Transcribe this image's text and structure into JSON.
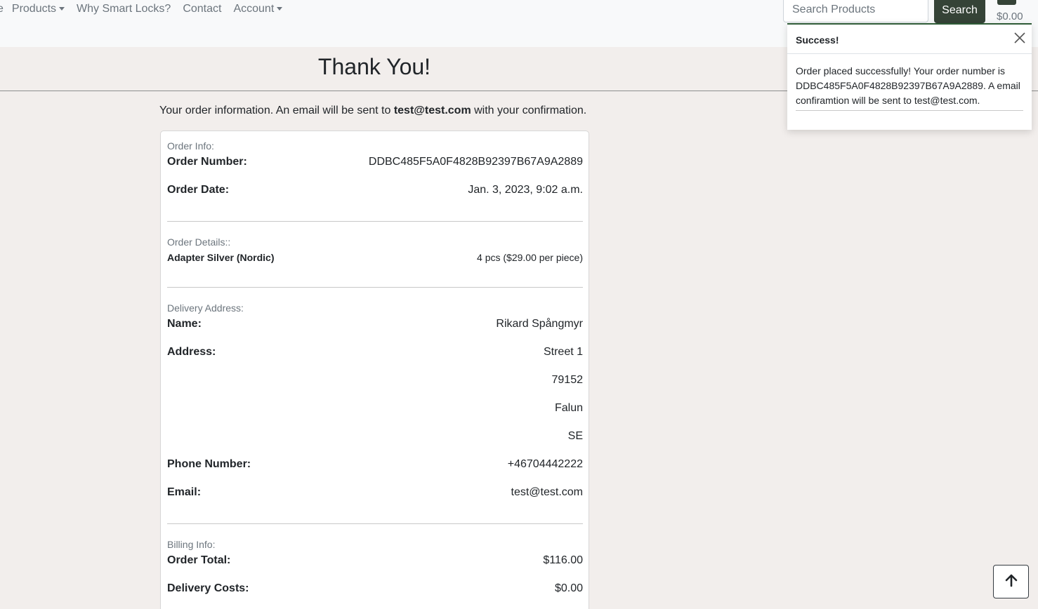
{
  "nav": {
    "cut_label": "e",
    "items": [
      {
        "label": "Products",
        "dropdown": true
      },
      {
        "label": "Why Smart Locks?",
        "dropdown": false
      },
      {
        "label": "Contact",
        "dropdown": false
      },
      {
        "label": "Account",
        "dropdown": true
      }
    ],
    "search_placeholder": "Search Products",
    "search_button": "Search",
    "cart_icon": "shopping-cart-icon",
    "cart_total": "$0.00"
  },
  "page": {
    "title": "Thank You!",
    "intro_prefix": "Your order information. An email will be sent to ",
    "intro_email": "test@test.com",
    "intro_suffix": " with your confirmation."
  },
  "order_info": {
    "label": "Order Info:",
    "order_number_key": "Order Number:",
    "order_number": "DDBC485F5A0F4828B92397B67A9A2889",
    "order_date_key": "Order Date:",
    "order_date": "Jan. 3, 2023, 9:02 a.m."
  },
  "order_details": {
    "label": "Order Details::",
    "item_name": "Adapter Silver (Nordic)",
    "item_qty": "4 pcs ($29.00 per piece)"
  },
  "delivery": {
    "label": "Delivery Address:",
    "name_key": "Name:",
    "name": "Rikard Spångmyr",
    "address_key": "Address:",
    "street": "Street 1",
    "postcode": "79152",
    "city": "Falun",
    "country": "SE",
    "phone_key": "Phone Number:",
    "phone": "+46704442222",
    "email_key": "Email:",
    "email": "test@test.com"
  },
  "billing": {
    "label": "Billing Info:",
    "total_key": "Order Total:",
    "total": "$116.00",
    "delivery_key": "Delivery Costs:",
    "delivery": "$0.00"
  },
  "toast": {
    "title": "Success!",
    "message": "Order placed successfully! Your order number is DDBC485F5A0F4828B92397B67A9A2889. A email confiramtion will be sent to test@test.com.",
    "close_icon": "close-icon"
  },
  "back_to_top_icon": "arrow-up-icon",
  "colors": {
    "accent": "#354337",
    "page_bg": "#f2eeec",
    "nav_bg": "#f8f9fa"
  }
}
